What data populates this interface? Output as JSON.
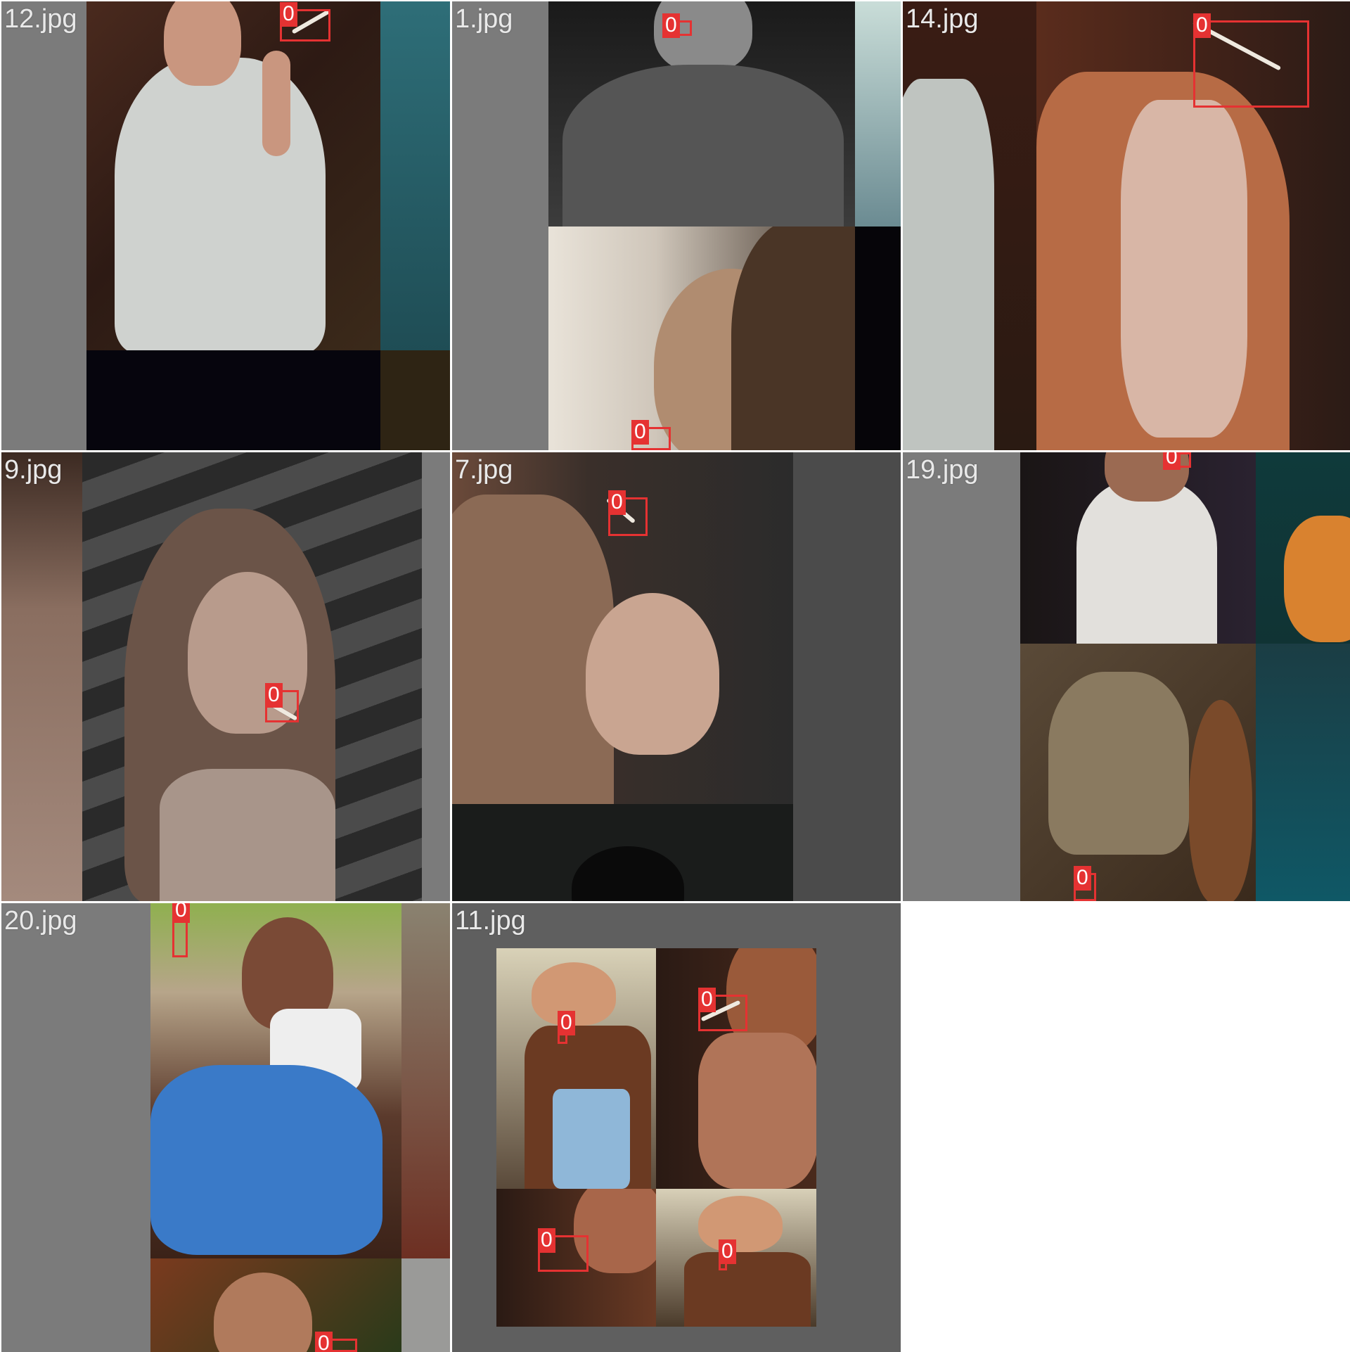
{
  "colors": {
    "grid_background": "#ffffff",
    "tile_padding_gray": "#7b7b7b",
    "bbox": "#e53232",
    "label_text": "#e9e9e9"
  },
  "tiles": [
    {
      "label": "12.jpg",
      "boxes": [
        {
          "cls": "0"
        }
      ]
    },
    {
      "label": "1.jpg",
      "boxes": [
        {
          "cls": "0"
        },
        {
          "cls": "0"
        }
      ]
    },
    {
      "label": "14.jpg",
      "boxes": [
        {
          "cls": "0"
        }
      ]
    },
    {
      "label": "9.jpg",
      "boxes": [
        {
          "cls": "0"
        }
      ]
    },
    {
      "label": "7.jpg",
      "boxes": [
        {
          "cls": "0"
        }
      ]
    },
    {
      "label": "19.jpg",
      "boxes": [
        {
          "cls": "0"
        },
        {
          "cls": "0"
        }
      ]
    },
    {
      "label": "20.jpg",
      "boxes": [
        {
          "cls": "0"
        },
        {
          "cls": "0"
        }
      ]
    },
    {
      "label": "11.jpg",
      "boxes": [
        {
          "cls": "0"
        },
        {
          "cls": "0"
        },
        {
          "cls": "0"
        },
        {
          "cls": "0"
        }
      ]
    }
  ]
}
